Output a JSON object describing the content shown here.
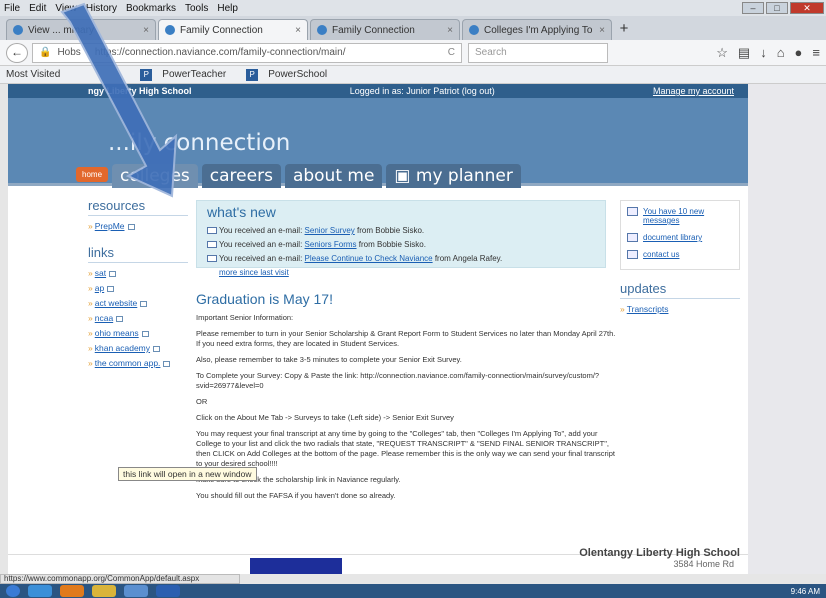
{
  "menu": [
    "File",
    "Edit",
    "View",
    "History",
    "Bookmarks",
    "Tools",
    "Help"
  ],
  "tabs": [
    {
      "label": "View ... mmary"
    },
    {
      "label": "Family Connection",
      "active": true
    },
    {
      "label": "Family Connection"
    },
    {
      "label": "Colleges I'm Applying To"
    }
  ],
  "nav": {
    "url": "https://connection.naviance.com/family-connection/main/",
    "url_prefix": "Hobs",
    "search_placeholder": "Search"
  },
  "bookmarks": [
    "Most Visited",
    "PowerTeacher",
    "PowerSchool"
  ],
  "site": {
    "school_short": "ngy Liberty High School",
    "logged_in": "Logged in as: Junior Patriot (log out)",
    "manage": "Manage my account",
    "title": "...ily connection"
  },
  "navtabs": {
    "home": "home",
    "items": [
      "colleges",
      "careers",
      "about me",
      "my planner"
    ]
  },
  "left": {
    "resources_head": "resources",
    "resources": [
      "PrepMe"
    ],
    "links_head": "links",
    "links": [
      "sat",
      "ap",
      "act website",
      "ncaa",
      "ohio means",
      "khan academy",
      "the common app."
    ]
  },
  "tooltip": "this link will open in a new window",
  "whatsnew": {
    "title": "what's new",
    "items": [
      {
        "pre": "You received an e-mail: ",
        "link": "Senior Survey",
        "post": " from Bobbie Sisko."
      },
      {
        "pre": "You received an e-mail: ",
        "link": "Seniors Forms",
        "post": " from Bobbie Sisko."
      },
      {
        "pre": "You received an e-mail: ",
        "link": "Please Continue to Check Naviance",
        "post": " from Angela Rafey."
      }
    ],
    "more": "more since last visit"
  },
  "right": {
    "messages": "You have 10 new messages",
    "doclib": "document library",
    "contact": "contact us",
    "updates_head": "updates",
    "updates": [
      "Transcripts"
    ]
  },
  "grad": {
    "title": "Graduation is May 17!",
    "p1": "Important Senior Information:",
    "p2": "Please remember to turn in your Senior Scholarship & Grant Report Form to Student Services no later than Monday April 27th. If you need extra forms, they are located in Student Services.",
    "p3": "Also, please remember to take 3-5 minutes to complete your Senior Exit Survey.",
    "p4": "To Complete your Survey: Copy & Paste the link:   http://connection.naviance.com/family-connection/main/survey/custom/?svid=26977&level=0",
    "p5": "OR",
    "p6": "Click on the About Me Tab -> Surveys to take (Left side) -> Senior Exit Survey",
    "p7": "You may request your final transcript at any time by going to the \"Colleges\" tab, then \"Colleges I'm Applying To\", add your College to your list and click the two radials that state, \"REQUEST TRANSCRIPT\" & \"SEND FINAL SENIOR TRANSCRIPT\", then CLICK on Add Colleges at the bottom of the page. Please remember this is the only way we can send your final transcript to your desired school!!!!",
    "p8": "Make sure to check the scholarship link in Naviance regularly.",
    "p9": "You should fill out the FAFSA if you haven't done so already."
  },
  "footer": {
    "school": "Olentangy Liberty High School",
    "addr": "3584 Home Rd"
  },
  "status": "https://www.commonapp.org/CommonApp/default.aspx",
  "clock": "9:46 AM"
}
